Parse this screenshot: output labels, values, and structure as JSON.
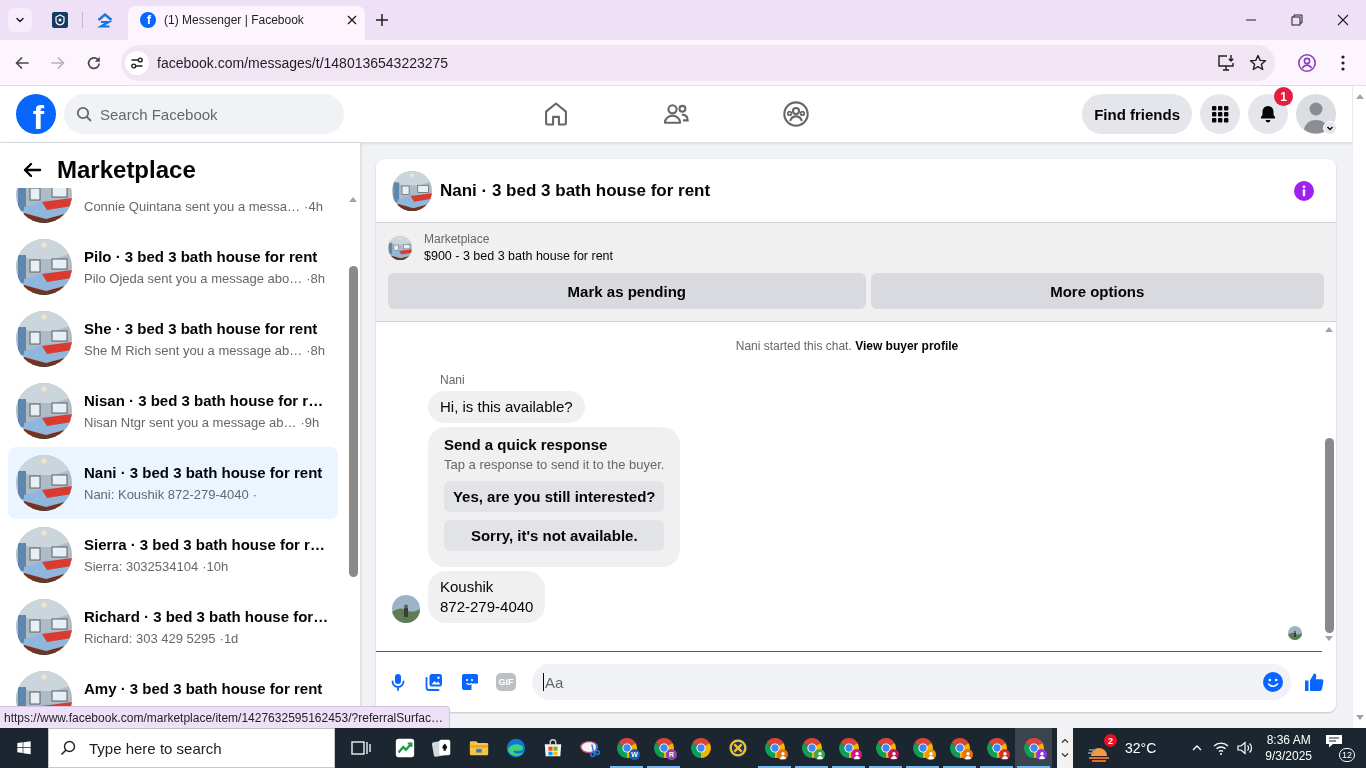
{
  "browser": {
    "tabs": [
      {
        "kind": "crest",
        "selected": false
      },
      {
        "kind": "house",
        "selected": false
      },
      {
        "kind": "page",
        "favicon": "f",
        "title": "(1) Messenger | Facebook",
        "selected": true
      }
    ],
    "nav_buttons": [
      {
        "kind": "back",
        "disabled": false
      },
      {
        "kind": "forward",
        "disabled": true
      },
      {
        "kind": "reload",
        "disabled": false
      }
    ],
    "url": "facebook.com/messages/t/1480136543223275",
    "status_url": "https://www.facebook.com/marketplace/item/1427632595162453/?referralSurfac…"
  },
  "facebook_header": {
    "logo": "f",
    "search": {
      "placeholder": "Search Facebook"
    },
    "find_friends": "Find friends",
    "notification_count": "1"
  },
  "sidebar": {
    "title": "Marketplace",
    "conversations": [
      {
        "preview": "Connie Quintana sent you a messa…",
        "time": "·4h",
        "selected": false
      },
      {
        "title": "Pilo · 3 bed 3 bath house for rent",
        "preview": "Pilo Ojeda sent you a message abo…",
        "time": "·8h",
        "selected": false
      },
      {
        "title": "She · 3 bed 3 bath house for rent",
        "preview": "She M Rich sent you a message ab…",
        "time": "·8h",
        "selected": false
      },
      {
        "title": "Nisan · 3 bed 3 bath house for r…",
        "preview": "Nisan Ntgr sent you a message ab…",
        "time": "·9h",
        "selected": false
      },
      {
        "title": "Nani · 3 bed 3 bath house for rent",
        "preview": "Nani: Koushik 872-279-4040",
        "time": "·",
        "selected": true
      },
      {
        "title": "Sierra · 3 bed 3 bath house for r…",
        "preview": "Sierra: 3032534104",
        "time": "·10h",
        "selected": false
      },
      {
        "title": "Richard · 3 bed 3 bath house for…",
        "preview": "Richard: 303 429 5295",
        "time": "·1d",
        "selected": false
      },
      {
        "title": "Amy · 3 bed 3 bath house for rent",
        "selected": false
      }
    ]
  },
  "chat": {
    "title": "Nani · 3 bed 3 bath house for rent",
    "listing": {
      "label": "Marketplace",
      "summary": "$900 - 3 bed 3 bath house for rent"
    },
    "actions": [
      "Mark as pending",
      "More options"
    ],
    "intro": "Nani started this chat.",
    "intro_link": "View buyer profile",
    "messages": [
      {
        "kind": "text",
        "sender": "Nani",
        "text": "Hi, is this available?",
        "avatar": false
      },
      {
        "kind": "quick_replies",
        "title": "Send a quick response",
        "subtitle": "Tap a response to send it to the buyer.",
        "options": [
          "Yes, are you still interested?",
          "Sorry, it's not available."
        ]
      },
      {
        "kind": "text",
        "text": "Koushik\n872-279-4040",
        "avatar": true
      }
    ],
    "composer": {
      "gif": {
        "label": "GIF",
        "disabled": true
      },
      "placeholder": "Aa"
    }
  },
  "taskbar": {
    "search": {
      "placeholder": "Type here to search"
    },
    "apps": [
      {
        "kind": "stocks",
        "running": false,
        "selected": false
      },
      {
        "kind": "cards",
        "running": false,
        "selected": false
      },
      {
        "kind": "folder",
        "running": false,
        "selected": false
      },
      {
        "kind": "edge",
        "running": false,
        "selected": false
      },
      {
        "kind": "store",
        "running": false,
        "selected": false
      },
      {
        "kind": "snip",
        "running": false,
        "selected": false
      },
      {
        "kind": "chrome",
        "badge": "W",
        "color": "#1a5fb4",
        "running": true,
        "selected": false
      },
      {
        "kind": "chrome",
        "badge": "R",
        "color": "#8e44ad",
        "running": true,
        "selected": false
      },
      {
        "kind": "chrome",
        "running": false,
        "selected": false
      },
      {
        "kind": "ring",
        "running": false,
        "selected": false
      },
      {
        "kind": "chrome",
        "color": "#e8710a",
        "running": true,
        "selected": false
      },
      {
        "kind": "chrome",
        "color": "#34a853",
        "running": true,
        "selected": false
      },
      {
        "kind": "chrome",
        "color": "#d01884",
        "running": true,
        "selected": false
      },
      {
        "kind": "chrome",
        "color": "#c2185b",
        "running": true,
        "selected": false
      },
      {
        "kind": "chrome",
        "color": "#f29900",
        "running": true,
        "selected": false
      },
      {
        "kind": "chrome",
        "color": "#e37400",
        "running": true,
        "selected": false
      },
      {
        "kind": "chrome",
        "color": "#d93025",
        "running": true,
        "selected": false
      },
      {
        "kind": "chrome",
        "color": "#9334e6",
        "running": true,
        "selected": true
      }
    ],
    "weather": {
      "alerts": "2",
      "temperature": "32°C"
    },
    "time": "8:36 AM",
    "date": "9/3/2025",
    "notifications": "12"
  }
}
